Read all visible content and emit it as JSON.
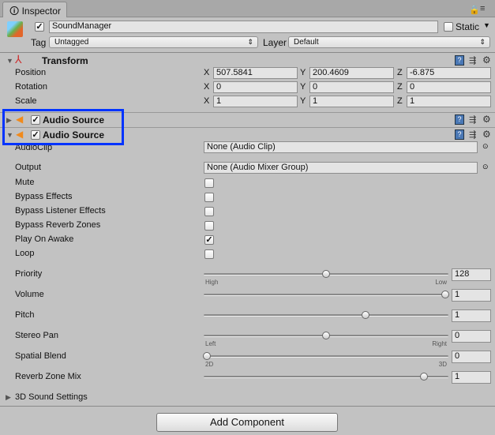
{
  "tab": {
    "title": "Inspector",
    "info_icon": "info-icon"
  },
  "gameobject": {
    "active": true,
    "name": "SoundManager",
    "static_label": "Static",
    "static": false,
    "tag_label": "Tag",
    "tag": "Untagged",
    "layer_label": "Layer",
    "layer": "Default"
  },
  "transform": {
    "title": "Transform",
    "rows": [
      {
        "label": "Position",
        "x": "507.5841",
        "y": "200.4609",
        "z": "-6.875"
      },
      {
        "label": "Rotation",
        "x": "0",
        "y": "0",
        "z": "0"
      },
      {
        "label": "Scale",
        "x": "1",
        "y": "1",
        "z": "1"
      }
    ],
    "axes": [
      "X",
      "Y",
      "Z"
    ]
  },
  "audio_sources": [
    {
      "title": "Audio Source",
      "enabled": true,
      "expanded": false
    },
    {
      "title": "Audio Source",
      "enabled": true,
      "expanded": true
    }
  ],
  "highlight_color": "#0033ff",
  "audio": {
    "audio_clip": {
      "label": "AudioClip",
      "value": "None (Audio Clip)"
    },
    "output": {
      "label": "Output",
      "value": "None (Audio Mixer Group)"
    },
    "toggles": [
      {
        "label": "Mute",
        "checked": false
      },
      {
        "label": "Bypass Effects",
        "checked": false
      },
      {
        "label": "Bypass Listener Effects",
        "checked": false
      },
      {
        "label": "Bypass Reverb Zones",
        "checked": false
      },
      {
        "label": "Play On Awake",
        "checked": true
      },
      {
        "label": "Loop",
        "checked": false
      }
    ],
    "sliders": [
      {
        "label": "Priority",
        "value": "128",
        "min": 0,
        "max": 256,
        "num": 128,
        "left": "High",
        "right": "Low"
      },
      {
        "label": "Volume",
        "value": "1",
        "min": 0,
        "max": 1,
        "num": 1
      },
      {
        "label": "Pitch",
        "value": "1",
        "min": -3,
        "max": 3,
        "num": 1
      },
      {
        "label": "Stereo Pan",
        "value": "0",
        "min": -1,
        "max": 1,
        "num": 0,
        "left": "Left",
        "right": "Right"
      },
      {
        "label": "Spatial Blend",
        "value": "0",
        "min": 0,
        "max": 1,
        "num": 0,
        "left": "2D",
        "right": "3D"
      },
      {
        "label": "Reverb Zone Mix",
        "value": "1",
        "min": 0,
        "max": 1.1,
        "num": 1
      }
    ],
    "sound_settings": "3D Sound Settings"
  },
  "add_component": "Add Component"
}
